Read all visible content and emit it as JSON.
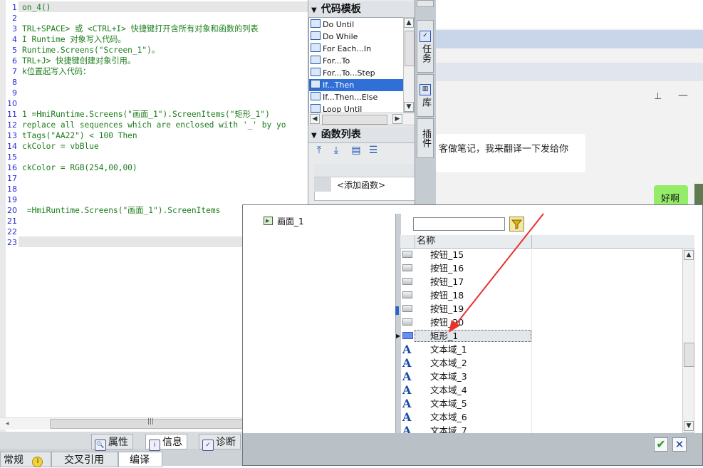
{
  "editor": {
    "line_numbers": [
      "1",
      "2",
      "3",
      "4",
      "5",
      "6",
      "7",
      "8",
      "9",
      "10",
      "11",
      "12",
      "13",
      "14",
      "15",
      "16",
      "17",
      "18",
      "19",
      "20",
      "21",
      "22",
      "23"
    ],
    "lines": [
      "on_4()",
      "",
      "TRL+SPACE> 或 <CTRL+I> 快捷键打开含所有对象和函数的列表",
      "I Runtime 对象写入代码。",
      "Runtime.Screens(\"Screen_1\")。",
      "TRL+J> 快捷键创建对象引用。",
      "k位置起写入代码：",
      "",
      "",
      "",
      "1 =HmiRuntime.Screens(\"画面_1\").ScreenItems(\"矩形_1\")",
      "replace all sequences which are enclosed with '_' by yo",
      "tTags(\"AA22\") < 100 Then",
      "ckColor = vbBlue",
      "",
      "ckColor = RGB(254,00,00)",
      "",
      "",
      "",
      " =HmiRuntime.Screens(\"画面_1\").ScreenItems",
      "",
      "",
      ""
    ],
    "hscroll_grip": "|||"
  },
  "bottom_tabs": {
    "properties": "属性",
    "info": "信息",
    "diagnostics": "诊断",
    "general": "常规",
    "cross_reference": "交叉引用",
    "compile": "编译"
  },
  "templates": {
    "title": "代码模板",
    "items": [
      "Do Until",
      "Do While",
      "For Each...In",
      "For...To",
      "For...To...Step",
      "If...Then",
      "If...Then...Else",
      "Loop Until"
    ],
    "selected_index": 5
  },
  "functions": {
    "title": "函数列表",
    "add_function": "<添加函数>"
  },
  "side_tabs": [
    "任务",
    "库",
    "插件"
  ],
  "chat": {
    "message": "客做笔记，我来翻译一下发给你",
    "reply": "好啊"
  },
  "dialog": {
    "tree_item": "画面_1",
    "filter_value": "",
    "column_name": "名称",
    "rows": [
      {
        "type": "button",
        "name": "按钮_15"
      },
      {
        "type": "button",
        "name": "按钮_16"
      },
      {
        "type": "button",
        "name": "按钮_17"
      },
      {
        "type": "button",
        "name": "按钮_18"
      },
      {
        "type": "button",
        "name": "按钮_19"
      },
      {
        "type": "button",
        "name": "按钮_20"
      },
      {
        "type": "rect",
        "name": "矩形_1"
      },
      {
        "type": "text",
        "name": "文本域_1"
      },
      {
        "type": "text",
        "name": "文本域_2"
      },
      {
        "type": "text",
        "name": "文本域_3"
      },
      {
        "type": "text",
        "name": "文本域_4"
      },
      {
        "type": "text",
        "name": "文本域_5"
      },
      {
        "type": "text",
        "name": "文本域_6"
      },
      {
        "type": "text",
        "name": "文本域_7"
      }
    ],
    "selected_index": 6,
    "text_icon_glyph": "A"
  },
  "colors": {
    "code_text": "#1c7d1c",
    "line_number": "#2b2bd6",
    "selection": "#2f6fd6",
    "arrow": "#e8322f"
  }
}
